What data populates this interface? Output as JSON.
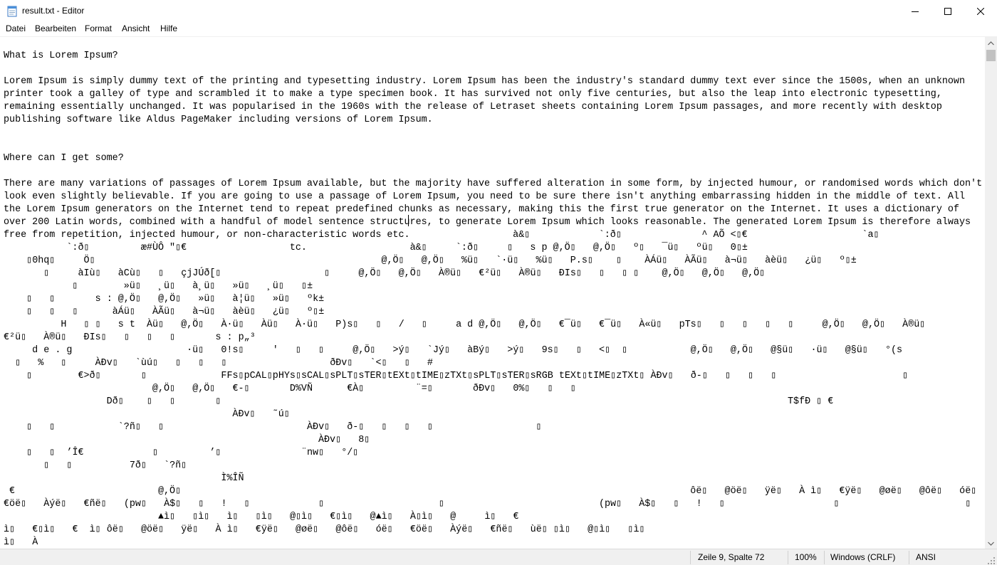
{
  "window": {
    "title": "result.txt - Editor"
  },
  "menu": {
    "items": [
      "Datei",
      "Bearbeiten",
      "Format",
      "Ansicht",
      "Hilfe"
    ]
  },
  "editor": {
    "lines": [
      "What is Lorem Ipsum?",
      "",
      "Lorem Ipsum is simply dummy text of the printing and typesetting industry. Lorem Ipsum has been the industry's standard dummy text ever since the 1500s, when an unknown",
      "printer took a galley of type and scrambled it to make a type specimen book. It has survived not only five centuries, but also the leap into electronic typesetting,",
      "remaining essentially unchanged. It was popularised in the 1960s with the release of Letraset sheets containing Lorem Ipsum passages, and more recently with desktop",
      "publishing software like Aldus PageMaker including versions of Lorem Ipsum.",
      "",
      "",
      "Where can I get some?",
      "",
      "There are many variations of passages of Lorem Ipsum available, but the majority have suffered alteration in some form, by injected humour, or randomised words which don't",
      "look even slightly believable. If you are going to use a passage of Lorem Ipsum, you need to be sure there isn't anything embarrassing hidden in the middle of text. All",
      "the Lorem Ipsum generators on the Internet tend to repeat predefined chunks as necessary, making this the first true generator on the Internet. It uses a dictionary of",
      "over 200 Latin words, combined with a handful of model sentence structures, to generate Lorem Ipsum which looks reasonable. The generated Lorem Ipsum is therefore always",
      "free from repetition, injected humour, or non-characteristic words etc.                  à&▯            `:ð▯              ^ AÕ <▯€                    `a▯",
      "           `:ð▯         æ#ÙÔ \"▯€                  tc.                  à&▯     `:ð▯     ▯   s p @,Ö▯   @,Ö▯   º▯   ¯ü▯   ºü▯   0▯±",
      "    ▯0hq▯     Ö▯                                                  @,Ö▯   @,Ö▯   %ü▯   `·ü▯   %ü▯   P.s▯    ▯    ÀÁü▯   ÀÃü▯   à¬ü▯   àèü▯   ¿ü▯   º▯±",
      "       ▯     àIù▯   àCù▯   ▯   çjJÚð[▯                  ▯     @,Ö▯   @,Ö▯   À®ü▯   €²ü▯   À®ü▯   ÐIs▯   ▯   ▯ ▯    @,Ö▯   @,Ö▯   @,Ö▯",
      "            ▯        »ü▯   ¸ü▯   à¸ü▯   »ü▯   ¸ü▯   ▯±",
      "    ▯   ▯       s : @,Ö▯   @,Ö▯   »ü▯   à¦ü▯   »ü▯   ºk±",
      "    ▯   ▯   ▯      àÁü▯   ÀÃü▯   à¬ü▯   àèü▯   ¿ü▯   º▯±",
      "          H   ▯ ▯   s t  Àü▯   @,Ö▯   À·ü▯   Àü▯   À·ü▯   P)s▯   ▯   /   ▯     a d @,Ö▯   @,Ö▯   €¯ü▯   €¯ü▯   À«ü▯   pTs▯   ▯   ▯   ▯   ▯     @,Ö▯   @,Ö▯   À®ü▯",
      "€²ü▯   À®ü▯   ÐIs▯   ▯   ▯   ▯       s : p„³",
      "     d e . g                    ·ü▯   0!s▯     '   ▯   ▯     @,Ö▯   >ý▯   `Jý▯   àBý▯   >ý▯   9s▯   ▯   <▯  ▯           @,Ö▯   @,Ö▯   @§ü▯   ·ü▯   @§ü▯   °(s",
      "  ▯   %   ▯     ÀÐv▯   `ùú▯   ▯   ▯   ▯                  ðÐv▯   `<▯   ▯   #",
      "    ▯        €>ð▯       ▯             FFs▯pCAL▯pHYs▯sCAL▯sPLT▯sTER▯tEXt▯tIME▯zTXt▯sPLT▯sTER▯sRGB tEXt▯tIME▯zTXt▯ ÀÐv▯   ð-▯   ▯   ▯   ▯                      ▯",
      "                          @,Ö▯   @,Ö▯   €-▯       D%VÑ      €À▯         ¨=▯       ðÐv▯   0%▯   ▯   ▯",
      "                  Dð▯    ▯   ▯       ▯                                                                                                   T$fÐ ▯ €",
      "                                        ÀÐv▯   ˜ú▯",
      "    ▯   ▯           `?ñ▯   ▯                         ÀÐv▯   ð-▯   ▯   ▯   ▯                  ▯",
      "                                                       ÀÐv▯   8▯",
      "    ▯   ▯  ’Î€            ▯         ’▯              ¨nw▯   °/▯",
      "       ▯   ▯          7ð▯   `?ñ▯",
      "                                      Ì%ÎÑ",
      " €                         @,Ö▯                                                                                         ôë▯   @öë▯   ÿë▯   À ì▯   €ÿë▯   @øë▯   @ôë▯   óë▯",
      "€öë▯   Àýë▯   €ñë▯   (pw▯   À$▯   ▯   !   ▯            ▯                    ▯                           (pw▯   À$▯   ▯   !   ▯                   ▯                      ▯",
      "                           ▲ì▯   ▯ì▯   ì▯   ▯ì▯   @▯ì▯   €▯ì▯   @▲ì▯   À▯ì▯   @     ì▯   €",
      "ì▯   €▯ì▯   €  ì▯ ôë▯   @öë▯   ÿë▯   À ì▯   €ÿë▯   @øë▯   @ôë▯   óë▯   €öë▯   Àýë▯   €ñë▯   ùë▯ ▯ì▯   @▯ì▯   ▯ì▯",
      "ì▯   À"
    ]
  },
  "status": {
    "position": "Zeile 9, Spalte 72",
    "zoom": "100%",
    "line_ending": "Windows (CRLF)",
    "encoding": "ANSI"
  },
  "icons": {
    "app": "notepad-icon",
    "minimize": "minimize-icon",
    "maximize": "maximize-icon",
    "close": "close-icon"
  }
}
